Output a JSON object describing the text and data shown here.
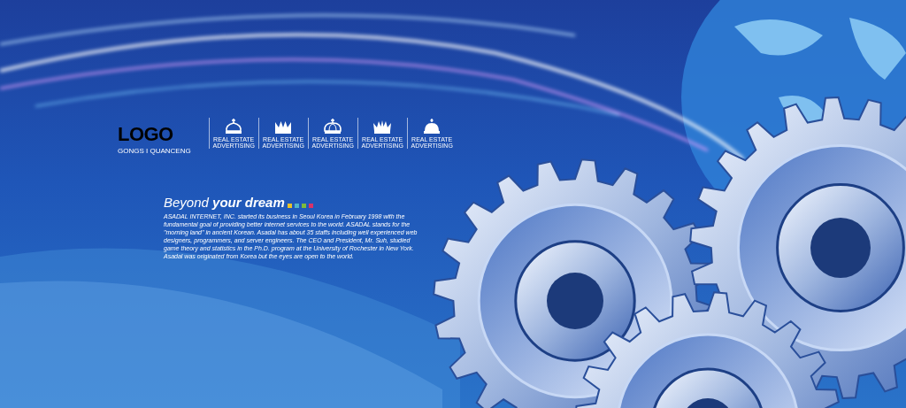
{
  "logo": {
    "wordmark": "LOGO",
    "tagline": "GONGS I QUANCENG"
  },
  "emblems": [
    {
      "kind": "cross-crown",
      "line_1": "REAL ESTATE",
      "line_2": "ADVERTISING"
    },
    {
      "kind": "five-point-crown",
      "line_1": "REAL ESTATE",
      "line_2": "ADVERTISING"
    },
    {
      "kind": "dome-cross-crown",
      "line_1": "REAL ESTATE",
      "line_2": "ADVERTISING"
    },
    {
      "kind": "spiked-crown",
      "line_1": "REAL ESTATE",
      "line_2": "ADVERTISING"
    },
    {
      "kind": "dome-crown",
      "line_1": "REAL ESTATE",
      "line_2": "ADVERTISING"
    }
  ],
  "headline": {
    "text": "Beyond **your dream**",
    "swatches": [
      {
        "color": "#e8c22a"
      },
      {
        "color": "#4fb3c9"
      },
      {
        "color": "#7dbb3c"
      },
      {
        "color": "#d8326a"
      }
    ]
  },
  "paragraph": "ASADAL INTERNET, INC. started its business in Seoul Korea in February 1998 with the fundamental goal of providing better internet services to the world. ASADAL stands for the \"morning land\" in ancient Korean. Asadal has about 35 staffs including well experienced web designers, programmers, and server engineers. The CEO and President, Mr. Suh, studied game theory and statistics in the Ph.D. program at the University of Rochester in New York. Asadal was originated from Korea but the eyes are open to the world."
}
